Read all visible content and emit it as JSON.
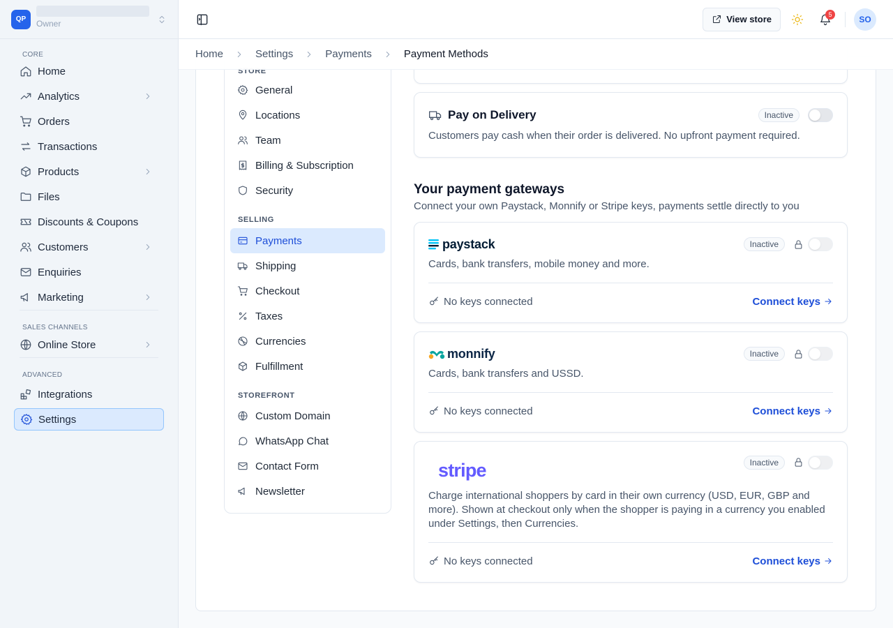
{
  "brand": {
    "logo_text": "QP",
    "role": "Owner"
  },
  "sidebar": {
    "core_heading": "CORE",
    "core_items": [
      {
        "label": "Home",
        "icon": "home-icon",
        "chevron": false
      },
      {
        "label": "Analytics",
        "icon": "trending-icon",
        "chevron": true
      },
      {
        "label": "Orders",
        "icon": "cart-icon",
        "chevron": false
      },
      {
        "label": "Transactions",
        "icon": "arrows-icon",
        "chevron": false
      },
      {
        "label": "Products",
        "icon": "box-icon",
        "chevron": true
      },
      {
        "label": "Files",
        "icon": "folder-icon",
        "chevron": false
      },
      {
        "label": "Discounts & Coupons",
        "icon": "ticket-icon",
        "chevron": false
      },
      {
        "label": "Customers",
        "icon": "users-icon",
        "chevron": true
      },
      {
        "label": "Enquiries",
        "icon": "mail-icon",
        "chevron": false
      },
      {
        "label": "Marketing",
        "icon": "megaphone-icon",
        "chevron": true
      }
    ],
    "channels_heading": "SALES CHANNELS",
    "online_store": "Online Store",
    "advanced_heading": "ADVANCED",
    "integrations": "Integrations",
    "settings": "Settings"
  },
  "topbar": {
    "view_store": "View store",
    "notification_count": "5",
    "avatar_initials": "SO"
  },
  "breadcrumb": [
    "Home",
    "Settings",
    "Payments",
    "Payment Methods"
  ],
  "subnav": {
    "store_heading": "STORE",
    "store_items": [
      "General",
      "Locations",
      "Team",
      "Billing & Subscription",
      "Security"
    ],
    "selling_heading": "SELLING",
    "selling_items": [
      "Payments",
      "Shipping",
      "Checkout",
      "Taxes",
      "Currencies",
      "Fulfillment"
    ],
    "storefront_heading": "STOREFRONT",
    "storefront_items": [
      "Custom Domain",
      "WhatsApp Chat",
      "Contact Form",
      "Newsletter"
    ]
  },
  "pay_on_delivery": {
    "title": "Pay on Delivery",
    "status": "Inactive",
    "description": "Customers pay cash when their order is delivered. No upfront payment required."
  },
  "gateways_section": {
    "title": "Your payment gateways",
    "subtitle": "Connect your own Paystack, Monnify or Stripe keys, payments settle directly to you"
  },
  "gateways": [
    {
      "logo": "paystack",
      "status": "Inactive",
      "description": "Cards, bank transfers, mobile money and more.",
      "keys": "No keys connected",
      "action": "Connect keys"
    },
    {
      "logo": "monnify",
      "status": "Inactive",
      "description": "Cards, bank transfers and USSD.",
      "keys": "No keys connected",
      "action": "Connect keys"
    },
    {
      "logo": "stripe",
      "status": "Inactive",
      "description": "Charge international shoppers by card in their own currency (USD, EUR, GBP and more). Shown at checkout only when the shopper is paying in a currency you enabled under Settings, then Currencies.",
      "keys": "No keys connected",
      "action": "Connect keys"
    }
  ],
  "colors": {
    "accent": "#2563eb",
    "link": "#1d4ed8",
    "stripe": "#635bff",
    "monnify_navy": "#0b2545"
  }
}
